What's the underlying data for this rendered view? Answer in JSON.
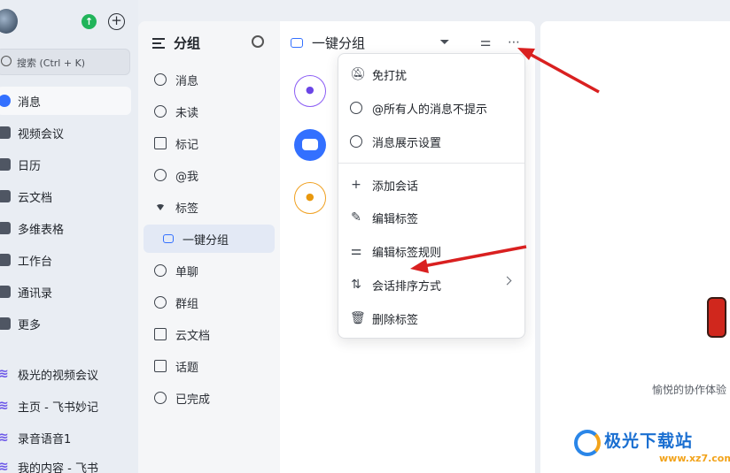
{
  "nav": {
    "search_placeholder": "搜索 (Ctrl + K)",
    "items": [
      {
        "label": "消息",
        "icon": "message-icon"
      },
      {
        "label": "视频会议",
        "icon": "video-icon"
      },
      {
        "label": "日历",
        "icon": "calendar-icon"
      },
      {
        "label": "云文档",
        "icon": "cloud-doc-icon"
      },
      {
        "label": "多维表格",
        "icon": "table-icon"
      },
      {
        "label": "工作台",
        "icon": "workbench-icon"
      },
      {
        "label": "通讯录",
        "icon": "contacts-icon"
      },
      {
        "label": "更多",
        "icon": "more-apps-icon"
      }
    ],
    "apps": [
      {
        "label": "极光的视频会议"
      },
      {
        "label": "主页 - 飞书妙记"
      },
      {
        "label": "录音语音1"
      },
      {
        "label": "我的内容 - 飞书"
      }
    ]
  },
  "groups": {
    "title": "分组",
    "items": [
      {
        "label": "消息"
      },
      {
        "label": "未读"
      },
      {
        "label": "标记"
      },
      {
        "label": "@我"
      },
      {
        "label": "标签"
      },
      {
        "label": "一键分组"
      },
      {
        "label": "单聊"
      },
      {
        "label": "群组"
      },
      {
        "label": "云文档"
      },
      {
        "label": "话题"
      },
      {
        "label": "已完成"
      }
    ]
  },
  "chatlist": {
    "title": "一键分组"
  },
  "menu": {
    "items": [
      {
        "label": "免打扰",
        "icon": "bell-off-icon"
      },
      {
        "label": "@所有人的消息不提示",
        "icon": "at-off-icon"
      },
      {
        "label": "消息展示设置",
        "icon": "eye-settings-icon"
      },
      {
        "label": "添加会话",
        "icon": "plus-icon"
      },
      {
        "label": "编辑标签",
        "icon": "pencil-icon"
      },
      {
        "label": "编辑标签规则",
        "icon": "sliders-icon"
      },
      {
        "label": "会话排序方式",
        "icon": "sort-icon"
      },
      {
        "label": "删除标签",
        "icon": "trash-icon"
      }
    ]
  },
  "rightpane": {
    "empty_text": "愉悦的协作体验"
  },
  "watermark": {
    "brand": "极光下载站",
    "url": "www.xz7.com"
  },
  "colors": {
    "accent": "#3370ff",
    "arrow": "#d92020"
  }
}
